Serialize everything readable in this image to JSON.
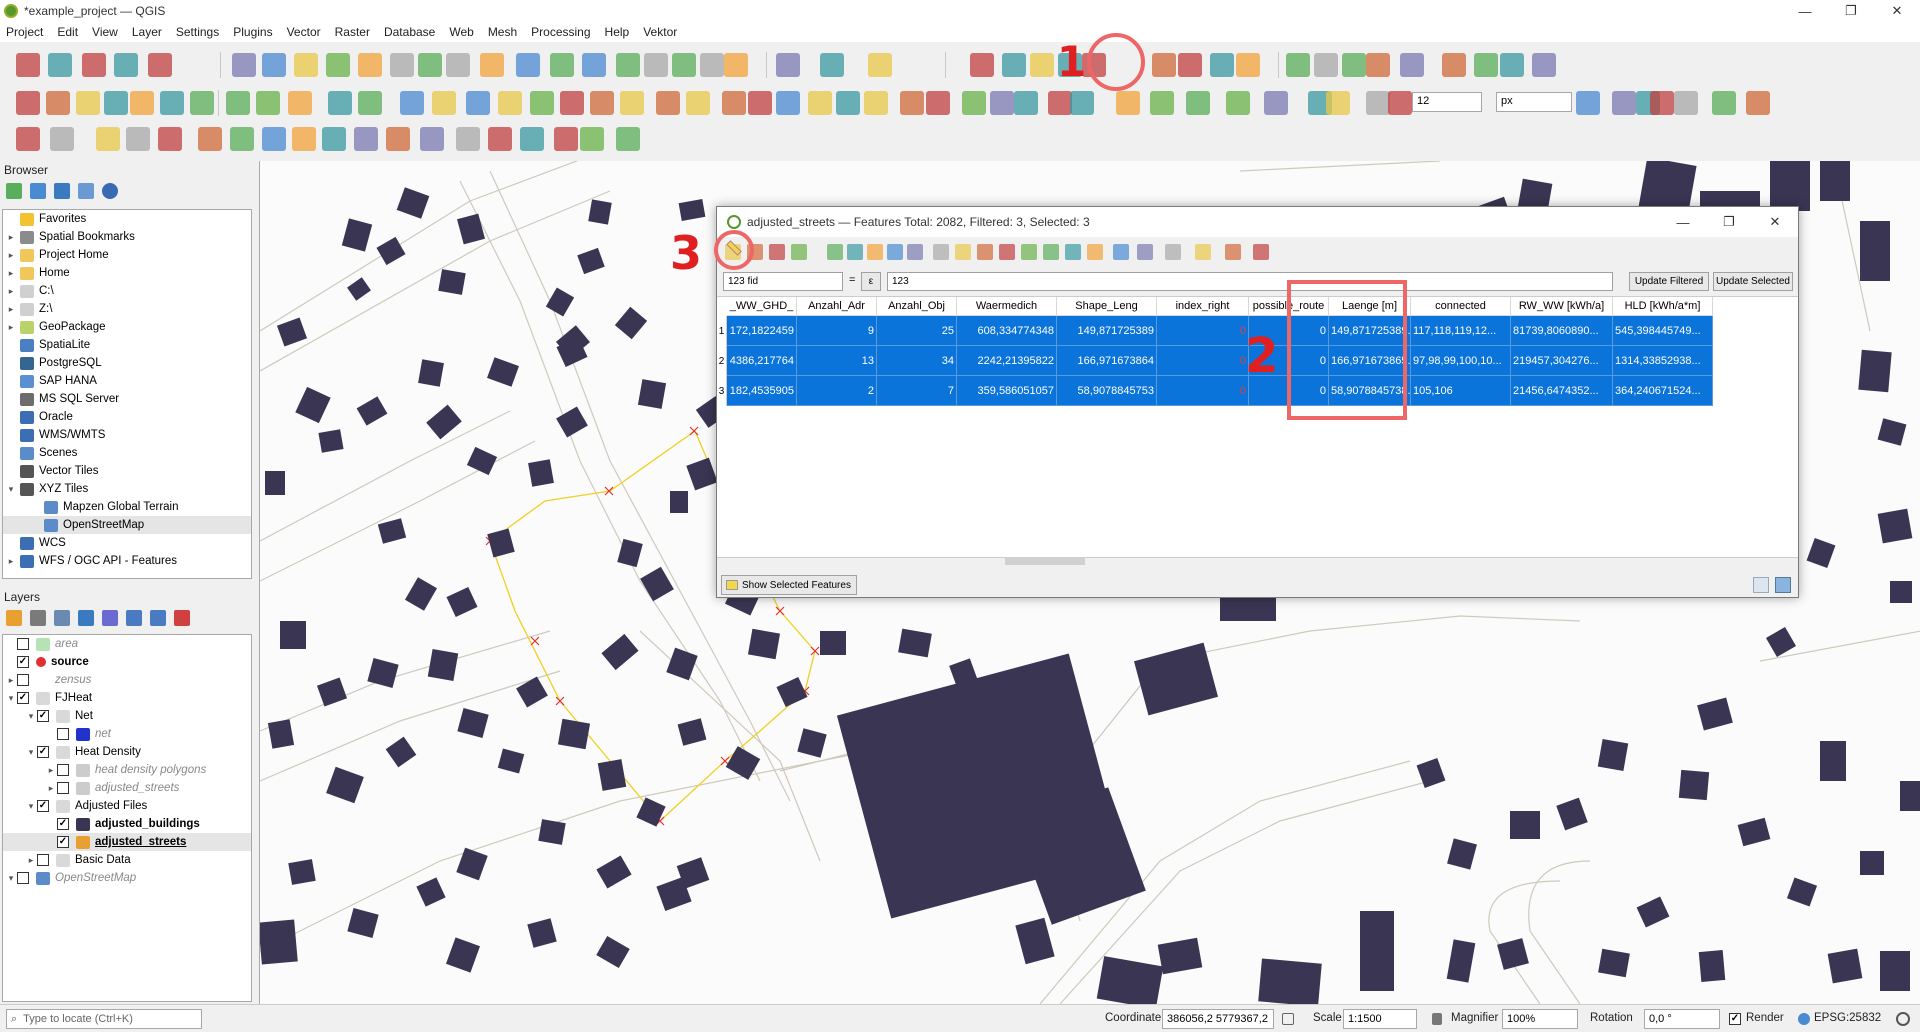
{
  "window": {
    "title": "*example_project — QGIS",
    "min": "—",
    "max": "❐",
    "close": "✕"
  },
  "menu": [
    "Project",
    "Edit",
    "View",
    "Layer",
    "Settings",
    "Plugins",
    "Vector",
    "Raster",
    "Database",
    "Web",
    "Mesh",
    "Processing",
    "Help",
    "Vektor"
  ],
  "toolbar": {
    "font_size_value": "12",
    "unit_value": "px"
  },
  "browser": {
    "title": "Browser",
    "items": [
      {
        "label": "Favorites",
        "expander": "",
        "icon_color": "#f2c230"
      },
      {
        "label": "Spatial Bookmarks",
        "expander": "▸",
        "icon_color": "#8b8b8b"
      },
      {
        "label": "Project Home",
        "expander": "▸",
        "icon_color": "#f1c75b"
      },
      {
        "label": "Home",
        "expander": "▸",
        "icon_color": "#f1c75b"
      },
      {
        "label": "C:\\",
        "expander": "▸",
        "icon_color": "#d0d0d0"
      },
      {
        "label": "Z:\\",
        "expander": "▸",
        "icon_color": "#d0d0d0"
      },
      {
        "label": "GeoPackage",
        "expander": "▸",
        "icon_color": "#b9d36b"
      },
      {
        "label": "SpatiaLite",
        "expander": "",
        "icon_color": "#4a7fc1"
      },
      {
        "label": "PostgreSQL",
        "expander": "",
        "icon_color": "#336791"
      },
      {
        "label": "SAP HANA",
        "expander": "",
        "icon_color": "#5a8fd1"
      },
      {
        "label": "MS SQL Server",
        "expander": "",
        "icon_color": "#6d6d6d"
      },
      {
        "label": "Oracle",
        "expander": "",
        "icon_color": "#3c6eb4"
      },
      {
        "label": "WMS/WMTS",
        "expander": "",
        "icon_color": "#3c6eb4"
      },
      {
        "label": "Scenes",
        "expander": "",
        "icon_color": "#5b8cc9"
      },
      {
        "label": "Vector Tiles",
        "expander": "",
        "icon_color": "#555555"
      },
      {
        "label": "XYZ Tiles",
        "expander": "▾",
        "icon_color": "#555555"
      },
      {
        "label": "Mapzen Global Terrain",
        "expander": "",
        "icon_color": "#5b8cc9",
        "indent": 1
      },
      {
        "label": "OpenStreetMap",
        "expander": "",
        "icon_color": "#5b8cc9",
        "indent": 1,
        "selected": true
      },
      {
        "label": "WCS",
        "expander": "",
        "icon_color": "#3c6eb4"
      },
      {
        "label": "WFS / OGC API - Features",
        "expander": "▸",
        "icon_color": "#3c6eb4"
      }
    ]
  },
  "layers": {
    "title": "Layers",
    "items": [
      {
        "label": "area",
        "checked": false,
        "style": "italic-grey",
        "icon_color": "#b6e3b6",
        "indent": 0,
        "expander": ""
      },
      {
        "label": "source",
        "checked": true,
        "style": "bold",
        "icon_color": "#e03030",
        "indent": 0,
        "expander": ""
      },
      {
        "label": "zensus",
        "checked": false,
        "style": "italic-grey",
        "icon_color": "#ffffff",
        "indent": 0,
        "expander": "▸"
      },
      {
        "label": "FJHeat",
        "checked": true,
        "style": "",
        "icon_color": "#d9d9d9",
        "indent": 0,
        "expander": "▾"
      },
      {
        "label": "Net",
        "checked": true,
        "style": "",
        "icon_color": "#d9d9d9",
        "indent": 1,
        "expander": "▾"
      },
      {
        "label": "net",
        "checked": false,
        "style": "italic-grey",
        "icon_color": "#2233cc",
        "indent": 2,
        "expander": ""
      },
      {
        "label": "Heat Density",
        "checked": true,
        "style": "",
        "icon_color": "#d9d9d9",
        "indent": 1,
        "expander": "▾"
      },
      {
        "label": "heat density polygons",
        "checked": false,
        "style": "italic-grey",
        "icon_color": "#cccccc",
        "indent": 2,
        "expander": "▸"
      },
      {
        "label": "adjusted_streets",
        "checked": false,
        "style": "italic-grey",
        "icon_color": "#cccccc",
        "indent": 2,
        "expander": "▸"
      },
      {
        "label": "Adjusted Files",
        "checked": true,
        "style": "",
        "icon_color": "#d9d9d9",
        "indent": 1,
        "expander": "▾"
      },
      {
        "label": "adjusted_buildings",
        "checked": true,
        "style": "bold",
        "icon_color": "#3a3552",
        "indent": 2,
        "expander": ""
      },
      {
        "label": "adjusted_streets",
        "checked": true,
        "style": "bold-underline",
        "icon_color": "#e8a030",
        "indent": 2,
        "expander": "",
        "selected": true
      },
      {
        "label": "Basic Data",
        "checked": false,
        "style": "",
        "icon_color": "#d9d9d9",
        "indent": 1,
        "expander": "▸"
      },
      {
        "label": "OpenStreetMap",
        "checked": false,
        "style": "italic-grey",
        "icon_color": "#5b8cc9",
        "indent": 0,
        "expander": "▾"
      }
    ]
  },
  "attribute_table": {
    "title": "adjusted_streets — Features Total: 2082, Filtered: 3, Selected: 3",
    "field_select": "123 fid",
    "operator": "=",
    "epsilon": "ε",
    "value": "123",
    "update_filtered": "Update Filtered",
    "update_selected": "Update Selected",
    "columns": [
      "_WW_GHD_",
      "Anzahl_Adr",
      "Anzahl_Obj",
      "Waermedich",
      "Shape_Leng",
      "index_right",
      "possible_route",
      "Laenge [m]",
      "connected",
      "RW_WW [kWh/a]",
      "HLD [kWh/a*m]"
    ],
    "rows": [
      {
        "num": "1",
        "cells": [
          "172,1822459",
          "9",
          "25",
          "608,334774348",
          "149,871725389",
          "0",
          "0",
          "149,871725389...",
          "117,118,119,12...",
          "81739,8060890...",
          "545,398445749..."
        ]
      },
      {
        "num": "2",
        "cells": [
          "4386,217764",
          "13",
          "34",
          "2242,21395822",
          "166,971673864",
          "0",
          "0",
          "166,971673865...",
          "97,98,99,100,10...",
          "219457,304276...",
          "1314,33852938..."
        ]
      },
      {
        "num": "3",
        "cells": [
          "182,4535905",
          "2",
          "7",
          "359,586051057",
          "58,9078845753",
          "0",
          "0",
          "58,9078845738...",
          "105,106",
          "21456,6474352...",
          "364,240671524..."
        ]
      }
    ],
    "show_features": "Show Selected Features"
  },
  "annotations": {
    "one": "1",
    "two": "2",
    "three": "3"
  },
  "statusbar": {
    "locate_placeholder": "Type to locate (Ctrl+K)",
    "coordinate_label": "Coordinate",
    "coordinate_value": "386056,2  5779367,2",
    "scale_label": "Scale",
    "scale_value": "1:1500",
    "magnifier_label": "Magnifier",
    "magnifier_value": "100%",
    "rotation_label": "Rotation",
    "rotation_value": "0,0 °",
    "render_label": "Render",
    "crs": "EPSG:25832"
  },
  "colors": {
    "selection": "#0a74da",
    "building": "#3a3552",
    "annotation": "#e02020",
    "route": "#f0d020"
  }
}
